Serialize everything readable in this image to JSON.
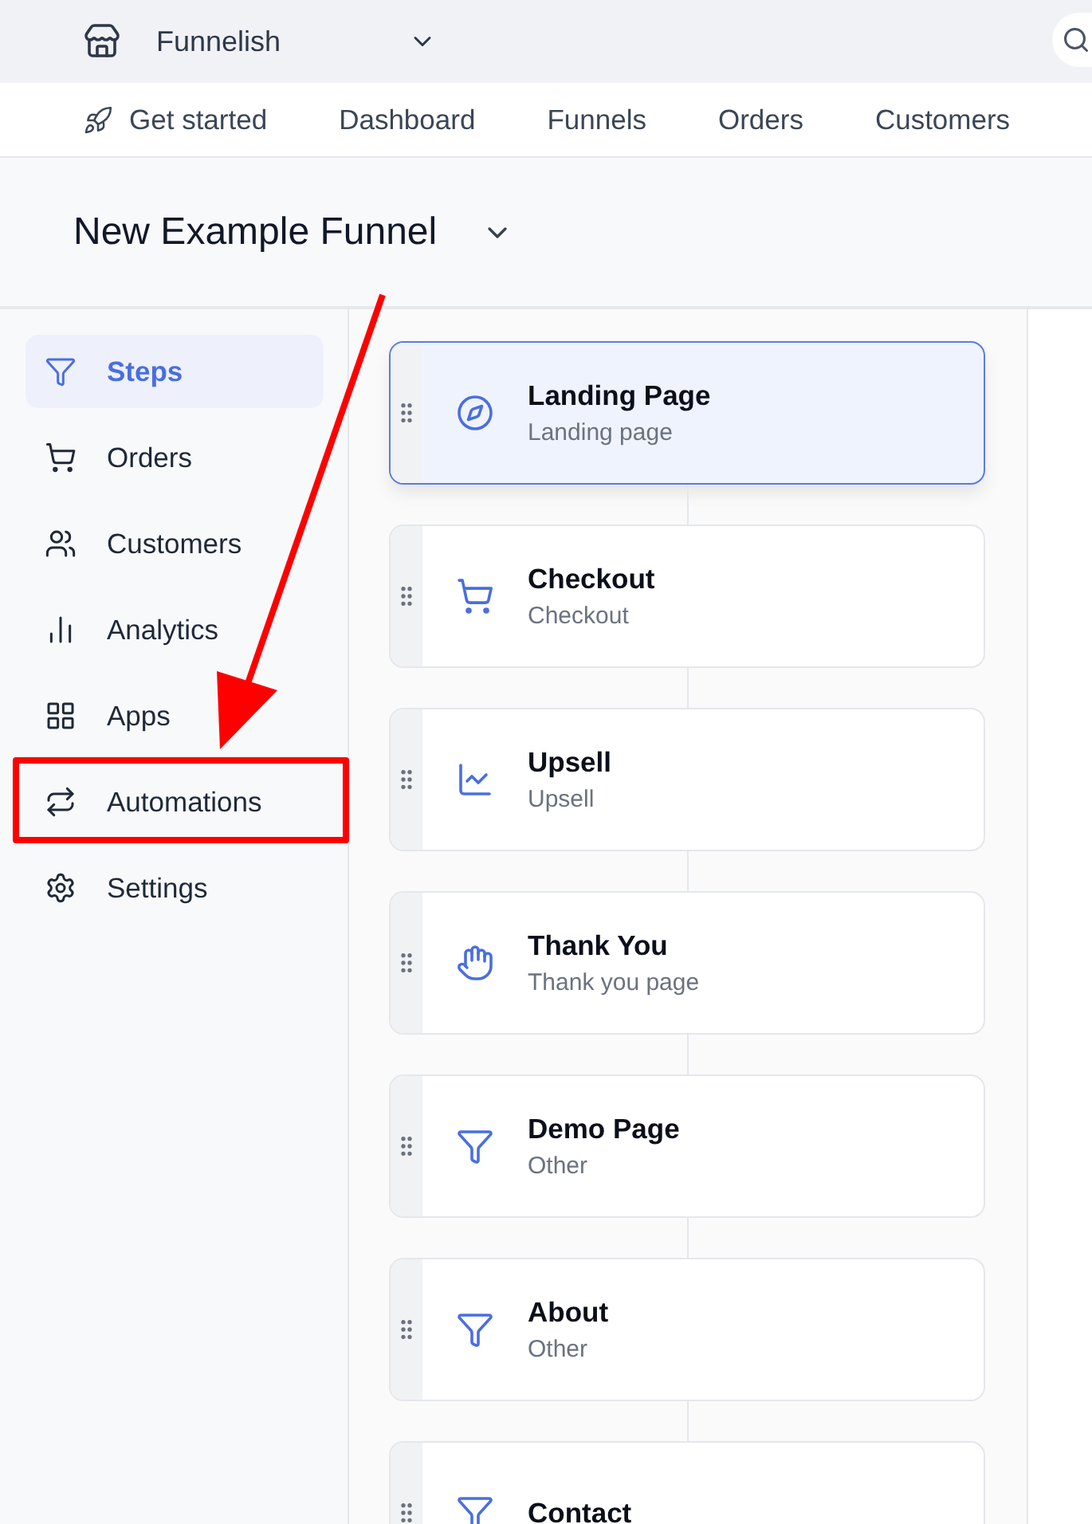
{
  "store_switcher": {
    "label": "Funnelish"
  },
  "nav": [
    {
      "label": "Get started",
      "selected": false
    },
    {
      "label": "Dashboard",
      "selected": false
    },
    {
      "label": "Funnels",
      "selected": false
    },
    {
      "label": "Orders",
      "selected": false
    },
    {
      "label": "Customers",
      "selected": false
    }
  ],
  "funnel": {
    "title": "New Example Funnel"
  },
  "sidebar": {
    "items": [
      {
        "label": "Steps",
        "selected": true
      },
      {
        "label": "Orders",
        "selected": false
      },
      {
        "label": "Customers",
        "selected": false
      },
      {
        "label": "Analytics",
        "selected": false
      },
      {
        "label": "Apps",
        "selected": false
      },
      {
        "label": "Automations",
        "selected": false
      },
      {
        "label": "Settings",
        "selected": false
      }
    ]
  },
  "steps": [
    {
      "kind": "landing",
      "title": "Landing Page",
      "subtitle": "Landing page",
      "selected": true
    },
    {
      "kind": "checkout",
      "title": "Checkout",
      "subtitle": "Checkout",
      "selected": false
    },
    {
      "kind": "upsell",
      "title": "Upsell",
      "subtitle": "Upsell",
      "selected": false
    },
    {
      "kind": "thankyou",
      "title": "Thank You",
      "subtitle": "Thank you page",
      "selected": false
    },
    {
      "kind": "other",
      "title": "Demo Page",
      "subtitle": "Other",
      "selected": false
    },
    {
      "kind": "other",
      "title": "About",
      "subtitle": "Other",
      "selected": false
    },
    {
      "kind": "other",
      "title": "Contact",
      "selected": false
    }
  ]
}
